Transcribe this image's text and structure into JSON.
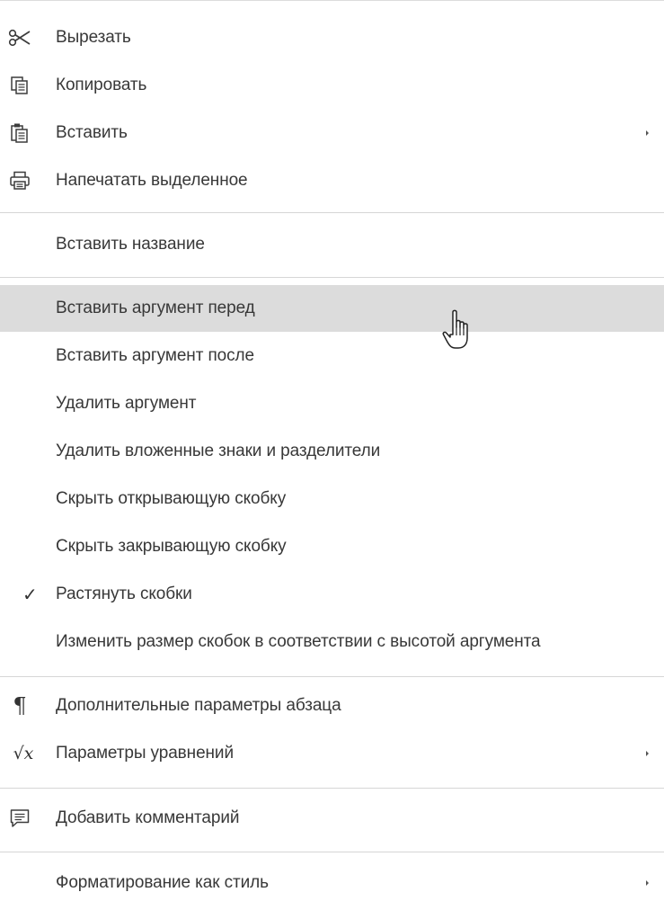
{
  "menu": {
    "cut": "Вырезать",
    "copy": "Копировать",
    "paste": "Вставить",
    "print_selection": "Напечатать выделенное",
    "insert_caption": "Вставить название",
    "insert_arg_before": "Вставить аргумент перед",
    "insert_arg_after": "Вставить аргумент после",
    "delete_arg": "Удалить аргумент",
    "delete_enclosing": "Удалить вложенные знаки и разделители",
    "hide_open_bracket": "Скрыть открывающую скобку",
    "hide_close_bracket": "Скрыть закрывающую скобку",
    "stretch_brackets": "Растянуть скобки",
    "match_bracket_size": "Изменить размер скобок в соответствии с высотой аргумента",
    "paragraph_settings": "Дополнительные параметры абзаца",
    "equation_settings": "Параметры уравнений",
    "add_comment": "Добавить комментарий",
    "format_as_style": "Форматирование как стиль"
  },
  "icons": {
    "cut": "scissors-icon",
    "copy": "copy-icon",
    "paste": "paste-icon",
    "print": "printer-icon",
    "check": "checkmark-icon",
    "paragraph": "pilcrow-icon",
    "equation": "sqrt-x-icon",
    "comment": "comment-icon",
    "submenu": "submenu-arrow-icon",
    "cursor": "hand-pointer-cursor"
  },
  "glyphs": {
    "check": "✓",
    "pilcrow": "¶",
    "equation": "√x"
  },
  "state": {
    "hovered_item": "insert_arg_before",
    "stretch_brackets_checked": true
  },
  "colors": {
    "hover_bg": "#dcdcdc",
    "separator": "#d6d6d6",
    "text": "#383838"
  }
}
